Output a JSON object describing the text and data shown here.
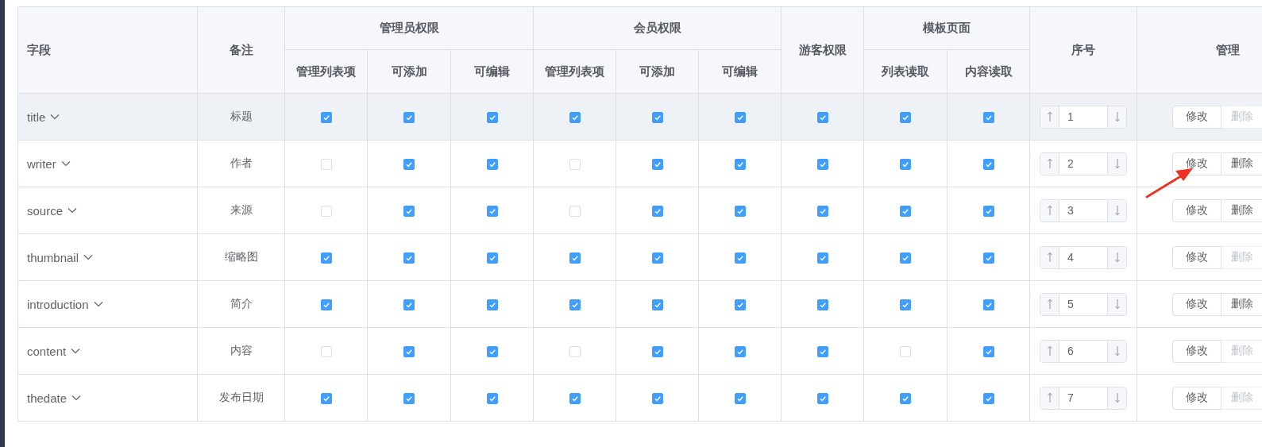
{
  "table": {
    "columns": [
      {
        "label": "字段"
      },
      {
        "label": "备注"
      },
      {
        "label": "管理员权限",
        "children": [
          {
            "label": "管理列表项"
          },
          {
            "label": "可添加"
          },
          {
            "label": "可编辑"
          }
        ]
      },
      {
        "label": "会员权限",
        "children": [
          {
            "label": "管理列表项"
          },
          {
            "label": "可添加"
          },
          {
            "label": "可编辑"
          }
        ]
      },
      {
        "label": "游客权限"
      },
      {
        "label": "模板页面",
        "children": [
          {
            "label": "列表读取"
          },
          {
            "label": "内容读取"
          }
        ]
      },
      {
        "label": "序号"
      },
      {
        "label": "管理"
      }
    ],
    "rows": [
      {
        "field": "title",
        "note": "标题",
        "highlighted": true,
        "permissions": [
          true,
          true,
          true,
          true,
          true,
          true,
          true,
          true,
          true
        ],
        "order": "1",
        "actions": [
          {
            "label": "修改",
            "disabled": false
          },
          {
            "label": "删除",
            "disabled": true
          }
        ]
      },
      {
        "field": "writer",
        "note": "作者",
        "highlighted": false,
        "permissions": [
          false,
          true,
          true,
          false,
          true,
          true,
          true,
          true,
          true
        ],
        "order": "2",
        "actions": [
          {
            "label": "修改",
            "disabled": false
          },
          {
            "label": "删除",
            "disabled": false
          }
        ]
      },
      {
        "field": "source",
        "note": "来源",
        "highlighted": false,
        "permissions": [
          false,
          true,
          true,
          false,
          true,
          true,
          true,
          true,
          true
        ],
        "order": "3",
        "actions": [
          {
            "label": "修改",
            "disabled": false
          },
          {
            "label": "删除",
            "disabled": false
          }
        ]
      },
      {
        "field": "thumbnail",
        "note": "缩略图",
        "highlighted": false,
        "permissions": [
          true,
          true,
          true,
          true,
          true,
          true,
          true,
          true,
          true
        ],
        "order": "4",
        "actions": [
          {
            "label": "修改",
            "disabled": false
          },
          {
            "label": "删除",
            "disabled": true
          }
        ]
      },
      {
        "field": "introduction",
        "note": "简介",
        "highlighted": false,
        "permissions": [
          true,
          true,
          true,
          true,
          true,
          true,
          true,
          true,
          true
        ],
        "order": "5",
        "actions": [
          {
            "label": "修改",
            "disabled": false
          },
          {
            "label": "删除",
            "disabled": false
          }
        ]
      },
      {
        "field": "content",
        "note": "内容",
        "highlighted": false,
        "permissions": [
          false,
          true,
          true,
          false,
          true,
          true,
          true,
          false,
          true
        ],
        "order": "6",
        "actions": [
          {
            "label": "修改",
            "disabled": false
          },
          {
            "label": "删除",
            "disabled": true
          }
        ]
      },
      {
        "field": "thedate",
        "note": "发布日期",
        "highlighted": false,
        "permissions": [
          true,
          true,
          true,
          true,
          true,
          true,
          true,
          true,
          true
        ],
        "order": "7",
        "actions": [
          {
            "label": "修改",
            "disabled": false
          },
          {
            "label": "删除",
            "disabled": true
          }
        ]
      }
    ]
  }
}
